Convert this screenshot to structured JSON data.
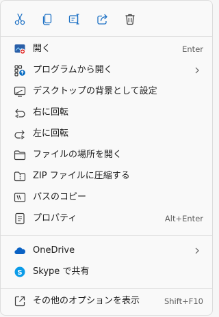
{
  "toolbar": {
    "cut_icon": "scissors-icon",
    "copy_icon": "copy-icon",
    "rename_icon": "rename-icon",
    "share_icon": "share-icon",
    "delete_icon": "trash-icon"
  },
  "items": [
    {
      "label": "開く",
      "accel": "Enter",
      "icon": "open-app-icon"
    },
    {
      "label": "プログラムから開く",
      "accel": "",
      "icon": "open-with-icon",
      "submenu": true
    },
    {
      "label": "デスクトップの背景として設定",
      "accel": "",
      "icon": "wallpaper-icon"
    },
    {
      "label": "右に回転",
      "accel": "",
      "icon": "rotate-right-icon"
    },
    {
      "label": "左に回転",
      "accel": "",
      "icon": "rotate-left-icon"
    },
    {
      "label": "ファイルの場所を開く",
      "accel": "",
      "icon": "folder-icon"
    },
    {
      "label": "ZIP ファイルに圧縮する",
      "accel": "",
      "icon": "zip-icon"
    },
    {
      "label": "パスのコピー",
      "accel": "",
      "icon": "copy-path-icon"
    },
    {
      "label": "プロパティ",
      "accel": "Alt+Enter",
      "icon": "properties-icon"
    },
    {
      "label": "OneDrive",
      "accel": "",
      "icon": "onedrive-icon",
      "submenu": true
    },
    {
      "label": "Skype で共有",
      "accel": "",
      "icon": "skype-icon"
    },
    {
      "label": "その他のオプションを表示",
      "accel": "Shift+F10",
      "icon": "more-options-icon"
    }
  ],
  "colors": {
    "accent": "#0067c0",
    "icon": "#3a3a3a",
    "text": "#1b1b1b",
    "muted": "#5e5e5e"
  }
}
